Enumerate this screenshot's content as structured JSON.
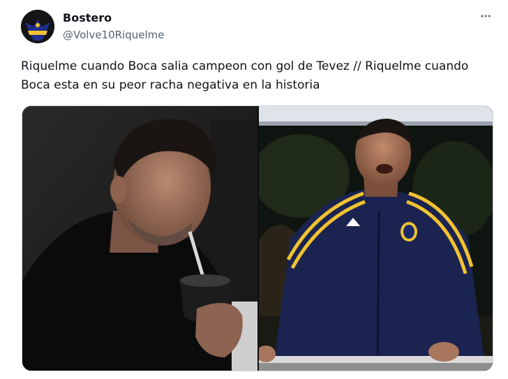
{
  "tweet": {
    "author": {
      "display_name": "Bostero",
      "handle": "@Volve10Riquelme",
      "avatar_icon": "boca-avatar"
    },
    "more_icon": "more-horizontal-icon",
    "text": "Riquelme cuando Boca salia campeon con gol de Tevez // Riquelme cuando Boca esta en su peor racha negativa en la historia",
    "media": [
      {
        "icon": "photo-riquelme-drinking-mate"
      },
      {
        "icon": "photo-riquelme-cheering-boca-jacket"
      }
    ]
  },
  "colors": {
    "text_primary": "#0f1419",
    "text_secondary": "#536471",
    "border": "#cfd9de",
    "boca_blue": "#1b2a6b",
    "boca_gold": "#f2c230"
  }
}
